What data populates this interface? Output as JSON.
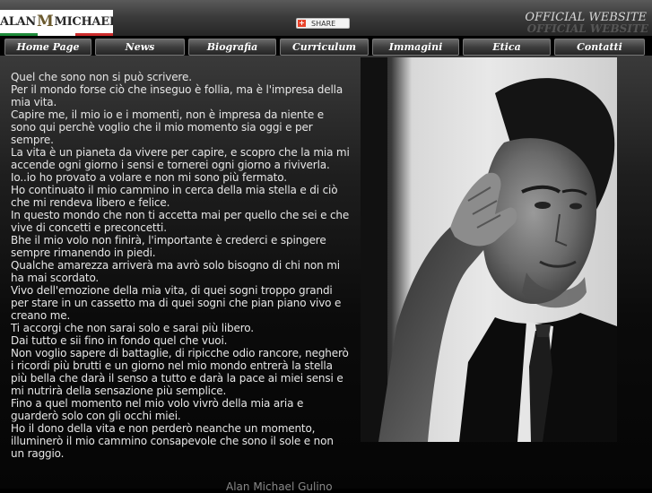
{
  "header": {
    "logo_left": "ALAN",
    "logo_mono": "M",
    "logo_right": "MICHAEL",
    "flag_colors": [
      "#1e8b3a",
      "#ffffff",
      "#cc2b2b"
    ],
    "share_label": "SHARE",
    "official_title": "OFFICIAL WEBSITE",
    "official_title_shadow": "OFFICIAL WEBSITE"
  },
  "nav": {
    "items": [
      {
        "label": "Home Page"
      },
      {
        "label": "News"
      },
      {
        "label": "Biografia"
      },
      {
        "label": "Curriculum"
      },
      {
        "label": "Immagini"
      },
      {
        "label": "Etica"
      },
      {
        "label": "Contatti"
      }
    ]
  },
  "poem": {
    "lines": [
      "Quel che sono non si può scrivere.",
      "Per il mondo forse ciò che inseguo è follia, ma è l'impresa della mia vita.",
      "Capire me, il mio io e i momenti, non è impresa da niente e sono qui perchè voglio che il mio momento sia oggi e per sempre.",
      "La vita è un pianeta da vivere per capire, e scopro che la mia mi accende ogni giorno i sensi e tornerei ogni giorno a riviverla.",
      "Io..io ho provato a volare e non mi sono più fermato.",
      "Ho continuato il mio cammino in cerca della mia stella e di ciò che mi rendeva libero e felice.",
      "In questo mondo che non ti accetta mai per quello che sei e che vive di concetti e preconcetti.",
      "Bhe il mio volo non finirà, l'importante è crederci e spingere sempre rimanendo in piedi.",
      "Qualche amarezza arriverà ma avrò solo bisogno di chi non mi ha mai scordato.",
      "Vivo dell'emozione della mia vita, di quei sogni troppo grandi per stare in un cassetto ma di quei sogni che pian piano vivo e creano me.",
      "Ti accorgi che non sarai solo e sarai più libero.",
      "Dai tutto e sii fino in fondo quel che vuoi.",
      "Non voglio sapere di battaglie, di ripicche odio rancore, negherò i ricordi più brutti e un giorno nel mio mondo entrerà la stella più bella che darà il senso a tutto e darà la pace ai miei sensi e mi nutrirà della sensazione più semplice.",
      "Fino a quel momento nel mio volo vivrò della mia aria e guarderò solo con gli occhi miei.",
      "Ho il dono della vita e non perderò neanche un momento, illuminerò il mio cammino consapevole che sono il sole e non un raggio."
    ],
    "signature": "Alan Michael Gulino"
  }
}
